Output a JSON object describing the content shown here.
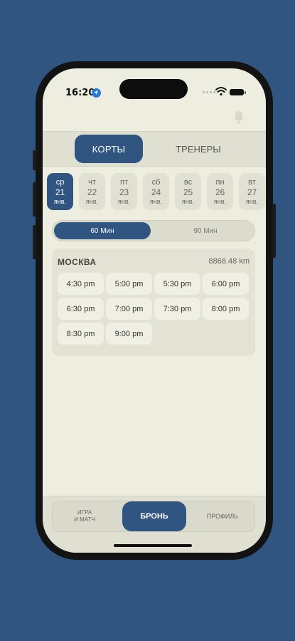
{
  "status": {
    "time": "16:20"
  },
  "tabs": {
    "courts": "КОРТЫ",
    "trainers": "ТРЕНЕРЫ"
  },
  "dates": [
    {
      "day": "ср",
      "num": "21",
      "month": "янв.",
      "active": true
    },
    {
      "day": "чт",
      "num": "22",
      "month": "янв.",
      "active": false
    },
    {
      "day": "пт",
      "num": "23",
      "month": "янв.",
      "active": false
    },
    {
      "day": "сб",
      "num": "24",
      "month": "янв.",
      "active": false
    },
    {
      "day": "вс",
      "num": "25",
      "month": "янв.",
      "active": false
    },
    {
      "day": "пн",
      "num": "26",
      "month": "янв.",
      "active": false
    },
    {
      "day": "вт",
      "num": "27",
      "month": "янв.",
      "active": false
    }
  ],
  "duration": {
    "opt60": "60 Мин",
    "opt90": "90 Мин",
    "selected": "60 Мин"
  },
  "venue": {
    "name": "МОСКВА",
    "distance": "8868.48 km",
    "slots": [
      "4:30 pm",
      "5:00 pm",
      "5:30 pm",
      "6:00 pm",
      "6:30 pm",
      "7:00 pm",
      "7:30 pm",
      "8:00 pm",
      "8:30 pm",
      "9:00 pm"
    ]
  },
  "nav": {
    "game_line1": "ИГРА",
    "game_line2": "И МАТЧ",
    "book": "БРОНЬ",
    "profile": "ПРОФИЛЬ"
  },
  "colors": {
    "accent": "#2f5580",
    "screen_bg": "#eeeee0"
  },
  "icons": {
    "location": "location-arrow-icon",
    "wifi": "wifi-icon",
    "battery": "battery-icon",
    "bell": "bell-icon"
  }
}
